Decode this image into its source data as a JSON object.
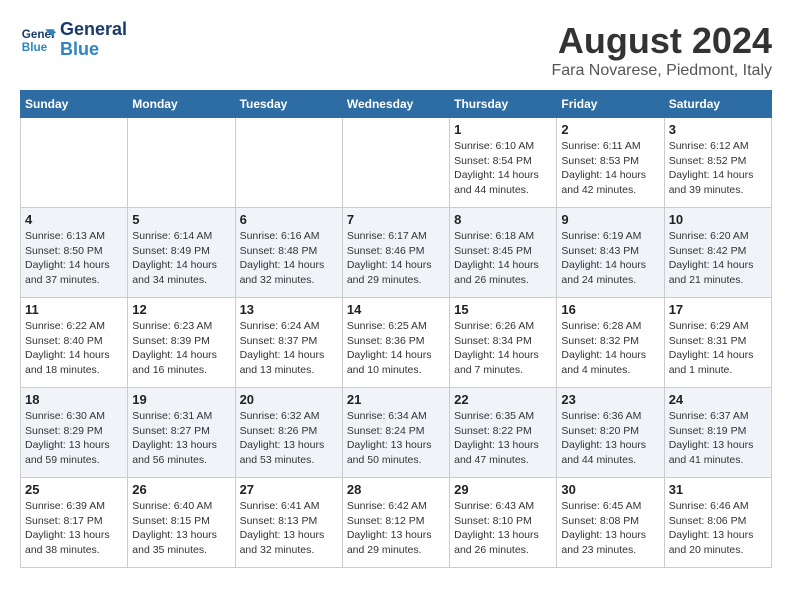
{
  "header": {
    "logo_line1": "General",
    "logo_line2": "Blue",
    "month_title": "August 2024",
    "location": "Fara Novarese, Piedmont, Italy"
  },
  "days_of_week": [
    "Sunday",
    "Monday",
    "Tuesday",
    "Wednesday",
    "Thursday",
    "Friday",
    "Saturday"
  ],
  "weeks": [
    [
      {
        "day": "",
        "info": ""
      },
      {
        "day": "",
        "info": ""
      },
      {
        "day": "",
        "info": ""
      },
      {
        "day": "",
        "info": ""
      },
      {
        "day": "1",
        "info": "Sunrise: 6:10 AM\nSunset: 8:54 PM\nDaylight: 14 hours\nand 44 minutes."
      },
      {
        "day": "2",
        "info": "Sunrise: 6:11 AM\nSunset: 8:53 PM\nDaylight: 14 hours\nand 42 minutes."
      },
      {
        "day": "3",
        "info": "Sunrise: 6:12 AM\nSunset: 8:52 PM\nDaylight: 14 hours\nand 39 minutes."
      }
    ],
    [
      {
        "day": "4",
        "info": "Sunrise: 6:13 AM\nSunset: 8:50 PM\nDaylight: 14 hours\nand 37 minutes."
      },
      {
        "day": "5",
        "info": "Sunrise: 6:14 AM\nSunset: 8:49 PM\nDaylight: 14 hours\nand 34 minutes."
      },
      {
        "day": "6",
        "info": "Sunrise: 6:16 AM\nSunset: 8:48 PM\nDaylight: 14 hours\nand 32 minutes."
      },
      {
        "day": "7",
        "info": "Sunrise: 6:17 AM\nSunset: 8:46 PM\nDaylight: 14 hours\nand 29 minutes."
      },
      {
        "day": "8",
        "info": "Sunrise: 6:18 AM\nSunset: 8:45 PM\nDaylight: 14 hours\nand 26 minutes."
      },
      {
        "day": "9",
        "info": "Sunrise: 6:19 AM\nSunset: 8:43 PM\nDaylight: 14 hours\nand 24 minutes."
      },
      {
        "day": "10",
        "info": "Sunrise: 6:20 AM\nSunset: 8:42 PM\nDaylight: 14 hours\nand 21 minutes."
      }
    ],
    [
      {
        "day": "11",
        "info": "Sunrise: 6:22 AM\nSunset: 8:40 PM\nDaylight: 14 hours\nand 18 minutes."
      },
      {
        "day": "12",
        "info": "Sunrise: 6:23 AM\nSunset: 8:39 PM\nDaylight: 14 hours\nand 16 minutes."
      },
      {
        "day": "13",
        "info": "Sunrise: 6:24 AM\nSunset: 8:37 PM\nDaylight: 14 hours\nand 13 minutes."
      },
      {
        "day": "14",
        "info": "Sunrise: 6:25 AM\nSunset: 8:36 PM\nDaylight: 14 hours\nand 10 minutes."
      },
      {
        "day": "15",
        "info": "Sunrise: 6:26 AM\nSunset: 8:34 PM\nDaylight: 14 hours\nand 7 minutes."
      },
      {
        "day": "16",
        "info": "Sunrise: 6:28 AM\nSunset: 8:32 PM\nDaylight: 14 hours\nand 4 minutes."
      },
      {
        "day": "17",
        "info": "Sunrise: 6:29 AM\nSunset: 8:31 PM\nDaylight: 14 hours\nand 1 minute."
      }
    ],
    [
      {
        "day": "18",
        "info": "Sunrise: 6:30 AM\nSunset: 8:29 PM\nDaylight: 13 hours\nand 59 minutes."
      },
      {
        "day": "19",
        "info": "Sunrise: 6:31 AM\nSunset: 8:27 PM\nDaylight: 13 hours\nand 56 minutes."
      },
      {
        "day": "20",
        "info": "Sunrise: 6:32 AM\nSunset: 8:26 PM\nDaylight: 13 hours\nand 53 minutes."
      },
      {
        "day": "21",
        "info": "Sunrise: 6:34 AM\nSunset: 8:24 PM\nDaylight: 13 hours\nand 50 minutes."
      },
      {
        "day": "22",
        "info": "Sunrise: 6:35 AM\nSunset: 8:22 PM\nDaylight: 13 hours\nand 47 minutes."
      },
      {
        "day": "23",
        "info": "Sunrise: 6:36 AM\nSunset: 8:20 PM\nDaylight: 13 hours\nand 44 minutes."
      },
      {
        "day": "24",
        "info": "Sunrise: 6:37 AM\nSunset: 8:19 PM\nDaylight: 13 hours\nand 41 minutes."
      }
    ],
    [
      {
        "day": "25",
        "info": "Sunrise: 6:39 AM\nSunset: 8:17 PM\nDaylight: 13 hours\nand 38 minutes."
      },
      {
        "day": "26",
        "info": "Sunrise: 6:40 AM\nSunset: 8:15 PM\nDaylight: 13 hours\nand 35 minutes."
      },
      {
        "day": "27",
        "info": "Sunrise: 6:41 AM\nSunset: 8:13 PM\nDaylight: 13 hours\nand 32 minutes."
      },
      {
        "day": "28",
        "info": "Sunrise: 6:42 AM\nSunset: 8:12 PM\nDaylight: 13 hours\nand 29 minutes."
      },
      {
        "day": "29",
        "info": "Sunrise: 6:43 AM\nSunset: 8:10 PM\nDaylight: 13 hours\nand 26 minutes."
      },
      {
        "day": "30",
        "info": "Sunrise: 6:45 AM\nSunset: 8:08 PM\nDaylight: 13 hours\nand 23 minutes."
      },
      {
        "day": "31",
        "info": "Sunrise: 6:46 AM\nSunset: 8:06 PM\nDaylight: 13 hours\nand 20 minutes."
      }
    ]
  ]
}
